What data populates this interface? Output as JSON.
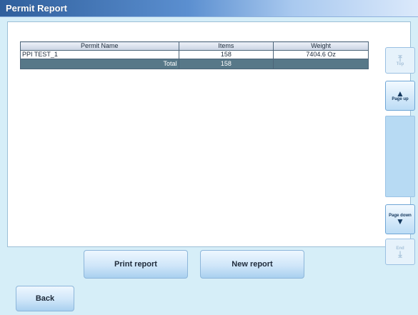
{
  "window": {
    "title": "Permit Report"
  },
  "table": {
    "headers": [
      "Permit Name",
      "Items",
      "Weight"
    ],
    "rows": [
      {
        "name": "PPI TEST_1",
        "items": "158",
        "weight": "7404.6 Oz"
      }
    ],
    "total": {
      "label": "Total",
      "items": "158",
      "weight": ""
    }
  },
  "scrollbar": {
    "top_label": "Top",
    "page_up_label": "Page up",
    "page_down_label": "Page down",
    "end_label": "End"
  },
  "actions": {
    "print_label": "Print report",
    "new_label": "New report",
    "back_label": "Back"
  },
  "colors": {
    "background": "#d6eef8",
    "title_bar": "#2f5f9c",
    "total_row": "#577888"
  }
}
